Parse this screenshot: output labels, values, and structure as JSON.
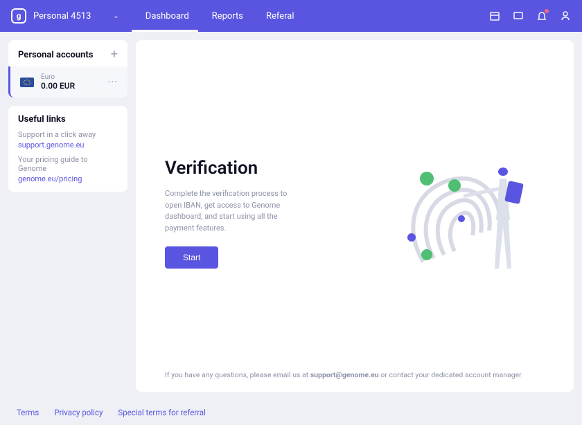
{
  "header": {
    "wallet_label": "Personal 4513",
    "nav": [
      {
        "label": "Dashboard"
      },
      {
        "label": "Reports"
      },
      {
        "label": "Referal"
      }
    ]
  },
  "sidebar": {
    "accounts_title": "Personal accounts",
    "account": {
      "currency": "Euro",
      "balance": "0.00 EUR"
    },
    "useful_title": "Useful links",
    "link1_text": "Support in a click away",
    "link1_url": "support.genome.eu",
    "link2_text": "Your pricing guide to Genome",
    "link2_url": "genome.eu/pricing"
  },
  "verification": {
    "title": "Verification",
    "body": "Complete the verification process to open IBAN, get access to Genome dashboard, and start using all the payment features.",
    "cta": "Start",
    "contact_prefix": "If you have any questions, please email us at ",
    "contact_email": "support@genome.eu",
    "contact_suffix": " or contact your dedicated account manager"
  },
  "footer": {
    "terms": "Terms",
    "privacy": "Privacy policy",
    "referral": "Special terms for referral"
  }
}
